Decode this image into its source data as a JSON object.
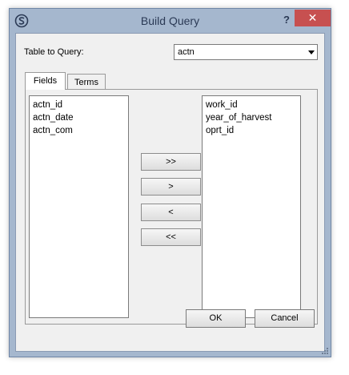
{
  "window": {
    "title": "Build Query",
    "help_label": "?",
    "close_label": "✕"
  },
  "query": {
    "table_label": "Table to Query:",
    "table_selected": "actn"
  },
  "tabs": [
    {
      "label": "Fields",
      "active": true
    },
    {
      "label": "Terms",
      "active": false
    }
  ],
  "fields": {
    "available": [
      "actn_id",
      "actn_date",
      "actn_com"
    ],
    "selected": [
      "work_id",
      "year_of_harvest",
      "oprt_id"
    ]
  },
  "move_buttons": {
    "add_all": ">>",
    "add_one": ">",
    "remove_one": "<",
    "remove_all": "<<"
  },
  "dialog_buttons": {
    "ok": "OK",
    "cancel": "Cancel"
  },
  "colors": {
    "frame": "#a5b7ce",
    "close": "#c75050",
    "client": "#f0f0f0"
  },
  "icons": {
    "app": "app-logo-icon",
    "close": "close-icon",
    "dropdown": "chevron-down-icon"
  }
}
